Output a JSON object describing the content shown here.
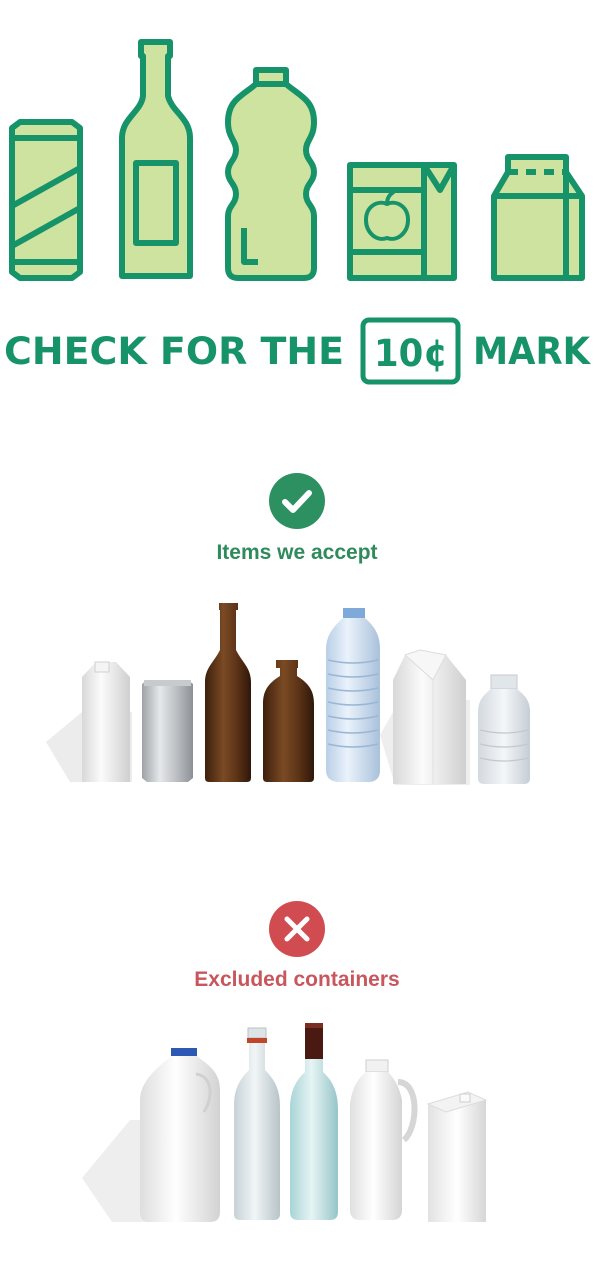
{
  "headline": {
    "lead": "CHECK FOR THE",
    "mark": "10¢",
    "tail": "MARK"
  },
  "hero_icons": [
    "can-icon",
    "glass-bottle-icon",
    "plastic-bottle-icon",
    "juice-box-icon",
    "milk-carton-icon"
  ],
  "accepted": {
    "title": "Items we accept",
    "status_icon": "check-icon",
    "color": "#2c9060",
    "items": [
      "juice-carton",
      "aluminium-can",
      "brown-beer-bottle",
      "brown-stubby-bottle",
      "plastic-water-bottle",
      "milk-carton",
      "small-plastic-bottle"
    ]
  },
  "excluded": {
    "title": "Excluded containers",
    "status_icon": "close-icon",
    "color": "#d14c51",
    "items": [
      "milk-jug",
      "glass-spirits-bottle",
      "wine-bottle",
      "plastic-cordial-bottle",
      "long-life-carton"
    ]
  },
  "colors": {
    "brand_green": "#17936a",
    "icon_fill": "#cfe3a0",
    "accept_text": "#2f8a5c",
    "excluded_text": "#c9565c"
  }
}
